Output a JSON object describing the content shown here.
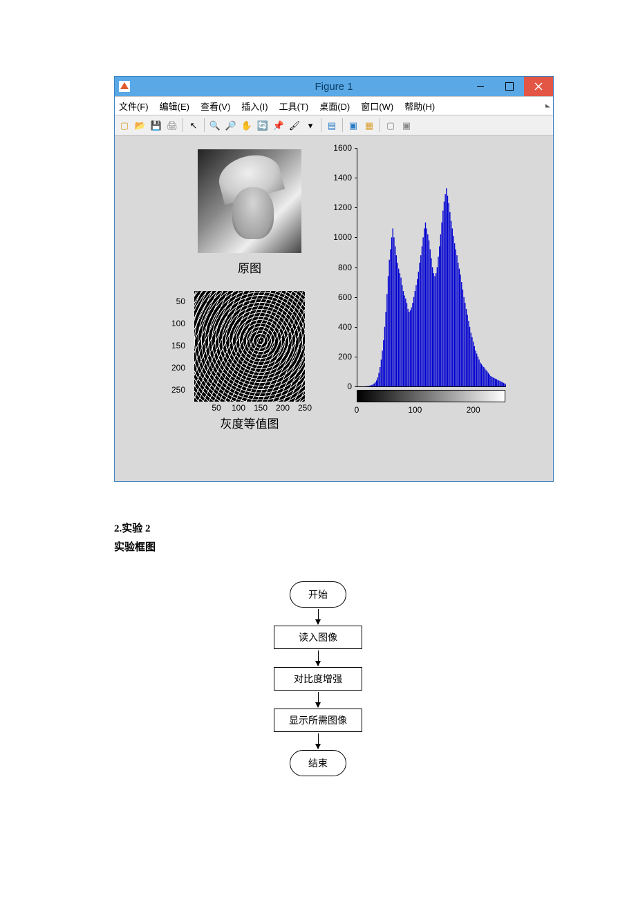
{
  "figure": {
    "title": "Figure 1",
    "menu": [
      "文件(F)",
      "编辑(E)",
      "查看(V)",
      "插入(I)",
      "工具(T)",
      "桌面(D)",
      "窗口(W)",
      "帮助(H)"
    ],
    "subplot1_caption": "原图",
    "subplot3_caption": "灰度等值图",
    "sp3_xticks": [
      "50",
      "100",
      "150",
      "200",
      "250"
    ],
    "sp3_yticks": [
      "50",
      "100",
      "150",
      "200",
      "250"
    ]
  },
  "chart_data": {
    "type": "bar",
    "title": "",
    "xlabel": "",
    "ylabel": "",
    "xlim": [
      0,
      255
    ],
    "ylim": [
      0,
      1600
    ],
    "xticks": [
      0,
      100,
      200
    ],
    "yticks": [
      0,
      200,
      400,
      600,
      800,
      1000,
      1200,
      1400,
      1600
    ],
    "bins": [
      0,
      2,
      4,
      6,
      8,
      10,
      12,
      14,
      16,
      18,
      20,
      22,
      24,
      26,
      28,
      30,
      32,
      34,
      36,
      38,
      40,
      42,
      44,
      46,
      48,
      50,
      52,
      54,
      56,
      58,
      60,
      62,
      64,
      66,
      68,
      70,
      72,
      74,
      76,
      78,
      80,
      82,
      84,
      86,
      88,
      90,
      92,
      94,
      96,
      98,
      100,
      102,
      104,
      106,
      108,
      110,
      112,
      114,
      116,
      118,
      120,
      122,
      124,
      126,
      128,
      130,
      132,
      134,
      136,
      138,
      140,
      142,
      144,
      146,
      148,
      150,
      152,
      154,
      156,
      158,
      160,
      162,
      164,
      166,
      168,
      170,
      172,
      174,
      176,
      178,
      180,
      182,
      184,
      186,
      188,
      190,
      192,
      194,
      196,
      198,
      200,
      202,
      204,
      206,
      208,
      210,
      212,
      214,
      216,
      218,
      220,
      222,
      224,
      226,
      228,
      230,
      232,
      234,
      236,
      238,
      240,
      242,
      244,
      246,
      248,
      250,
      252,
      254
    ],
    "values": [
      0,
      0,
      0,
      0,
      0,
      0,
      0,
      2,
      2,
      3,
      5,
      7,
      10,
      14,
      20,
      28,
      40,
      60,
      90,
      130,
      180,
      240,
      310,
      400,
      500,
      620,
      740,
      850,
      920,
      1000,
      1060,
      1000,
      940,
      880,
      830,
      790,
      760,
      730,
      680,
      640,
      610,
      590,
      560,
      520,
      500,
      510,
      530,
      560,
      600,
      640,
      680,
      720,
      770,
      830,
      880,
      940,
      1000,
      1060,
      1100,
      1060,
      1020,
      980,
      920,
      860,
      800,
      760,
      740,
      760,
      800,
      870,
      940,
      1020,
      1100,
      1180,
      1240,
      1290,
      1330,
      1280,
      1230,
      1170,
      1110,
      1060,
      1010,
      960,
      920,
      880,
      830,
      790,
      750,
      700,
      650,
      600,
      560,
      520,
      480,
      440,
      400,
      360,
      330,
      300,
      270,
      240,
      220,
      200,
      180,
      160,
      150,
      140,
      130,
      120,
      110,
      100,
      90,
      80,
      70,
      65,
      60,
      56,
      52,
      48,
      44,
      40,
      36,
      32,
      28,
      24,
      20,
      16
    ]
  },
  "doc": {
    "heading": "2.实验 2",
    "subheading": "实验框图"
  },
  "flow": {
    "start": "开始",
    "step1": "读入图像",
    "step2": "对比度增强",
    "step3": "显示所需图像",
    "end": "结束"
  }
}
